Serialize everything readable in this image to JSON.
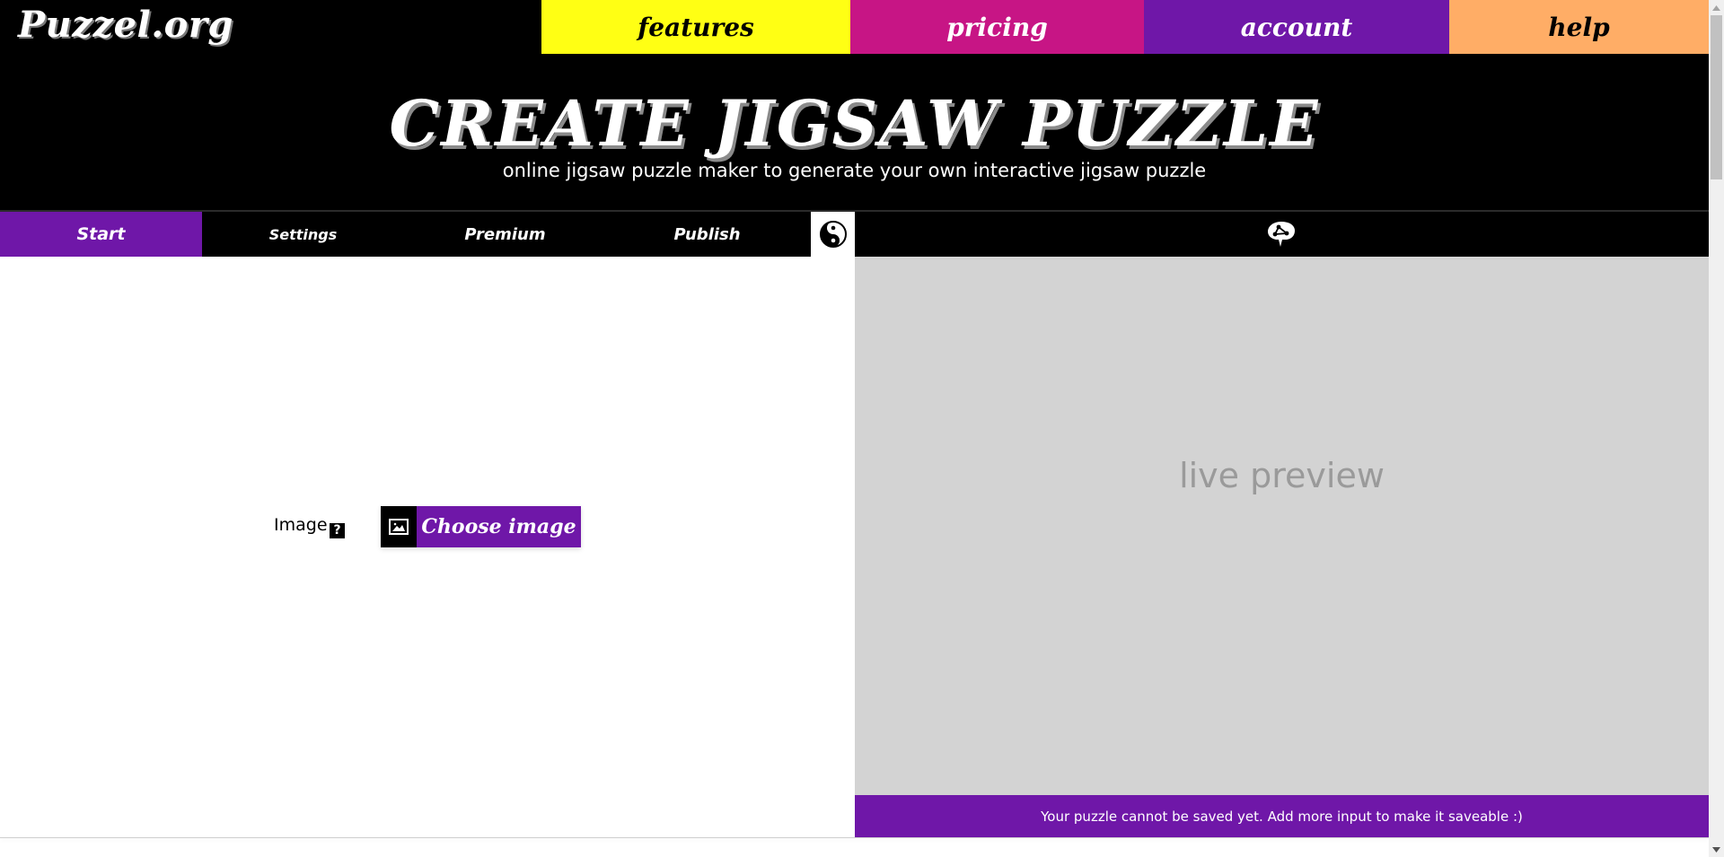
{
  "header": {
    "logo": "Puzzel.org",
    "nav": [
      {
        "label": "features",
        "color": "#ffff14"
      },
      {
        "label": "pricing",
        "color": "#c71585"
      },
      {
        "label": "account",
        "color": "#6f17a8"
      },
      {
        "label": "help",
        "color": "#ffad66"
      }
    ]
  },
  "hero": {
    "title": "CREATE JIGSAW PUZZLE",
    "subtitle": "online jigsaw puzzle maker to generate your own interactive jigsaw puzzle"
  },
  "tabs": {
    "items": [
      {
        "label": "Start",
        "active": true
      },
      {
        "label": "Settings",
        "active": false
      },
      {
        "label": "Premium",
        "active": false
      },
      {
        "label": "Publish",
        "active": false
      }
    ],
    "theme_toggle_icon": "yin-yang-icon",
    "share_icon": "brain-share-icon"
  },
  "editor": {
    "image_field": {
      "label": "Image",
      "help_icon": "?",
      "button_label": "Choose image",
      "button_icon": "image-icon"
    }
  },
  "preview": {
    "placeholder": "live preview",
    "save_status": "Your puzzle cannot be saved yet. Add more input to make it saveable :)"
  },
  "colors": {
    "accent": "#6f17a8",
    "preview_bg": "#d3d3d3"
  }
}
